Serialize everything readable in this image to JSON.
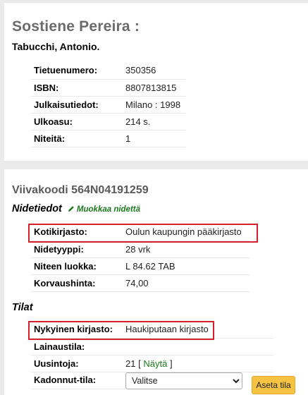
{
  "record": {
    "title": "Sostiene Pereira :",
    "author": "Tabucchi, Antonio.",
    "fields": [
      {
        "label": "Tietuenumero:",
        "value": "350356"
      },
      {
        "label": "ISBN:",
        "value": "8807813815"
      },
      {
        "label": "Julkaisutiedot:",
        "value": "Milano : 1998"
      },
      {
        "label": "Ulkoasu:",
        "value": "214 s."
      },
      {
        "label": "Niteitä:",
        "value": "1"
      }
    ]
  },
  "item": {
    "barcode_heading": "Viivakoodi 564N04191259",
    "details_heading": "Nidetiedot",
    "edit_label": "Muokkaa nidettä",
    "details": [
      {
        "label": "Kotikirjasto:",
        "value": "Oulun kaupungin pääkirjasto"
      },
      {
        "label": "Nidetyyppi:",
        "value": "28 vrk"
      },
      {
        "label": "Niteen luokka:",
        "value": "L 84.62 TAB"
      },
      {
        "label": "Korvaushinta:",
        "value": "74,00"
      }
    ],
    "status_heading": "Tilat",
    "status": {
      "current_library_label": "Nykyinen kirjasto:",
      "current_library_value": "Haukiputaan kirjasto",
      "loan_status_label": "Lainaustila:",
      "loan_status_value": "",
      "renewals_label": "Uusintoja:",
      "renewals_count": "21",
      "renewals_open": "[",
      "renewals_link": "Näytä",
      "renewals_close": "]",
      "lost_label": "Kadonnut-tila:",
      "lost_select_value": "Valitse",
      "set_button": "Aseta tila"
    }
  },
  "colors": {
    "highlight": "#d4202a",
    "button": "#f5c242",
    "link": "#1e7a1e"
  }
}
